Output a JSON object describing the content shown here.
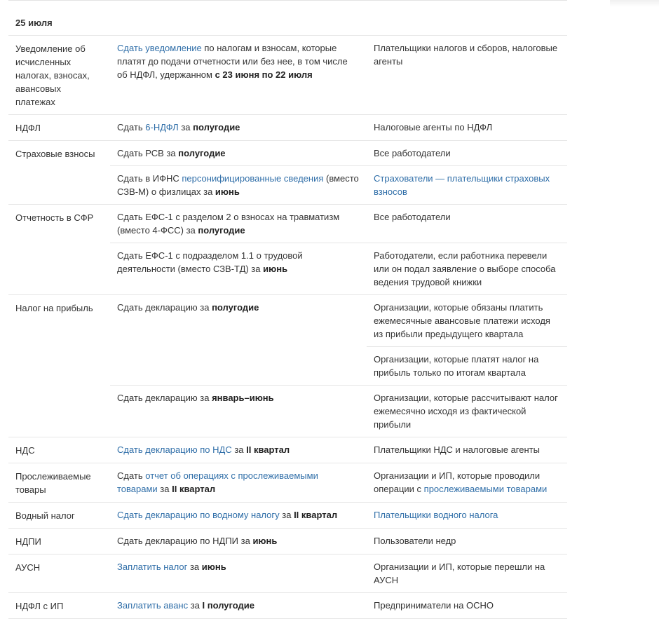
{
  "date_heading": "25 июля",
  "rows": [
    {
      "category": "Уведомление об исчисленных налогах, взносах, авансовых платежах",
      "action": {
        "link": "Сдать уведомление",
        "pre": "",
        "mid": " по налогам и взносам, которые платят до подачи отчетности или без нее, в том числе об НДФЛ, удержанном ",
        "bold": "с 23 июня по 22 июля",
        "post": ""
      },
      "payers": "Плательщики налогов и сборов, налоговые агенты"
    },
    {
      "category": "НДФЛ",
      "action": {
        "pre": "Сдать ",
        "link": "6-НДФЛ",
        "mid": " за ",
        "bold": "полугодие"
      },
      "payers": "Налоговые агенты по НДФЛ"
    },
    {
      "category": "Страховые взносы",
      "action": {
        "pre": "Сдать РСВ за ",
        "bold": "полугодие"
      },
      "payers": "Все работодатели"
    },
    {
      "category": "",
      "action": {
        "pre": "Сдать в ИФНС ",
        "link": "персонифицированные сведения",
        "mid": " (вместо СЗВ-М) о физлицах за ",
        "bold": "июнь"
      },
      "payers_link": "Страхователи — плательщики страховых взносов"
    },
    {
      "category": "Отчетность в СФР",
      "action": {
        "pre": "Сдать ЕФС-1 с разделом 2 о взносах на травматизм (вместо 4-ФСС) за ",
        "bold": "полугодие"
      },
      "payers": "Все работодатели"
    },
    {
      "category": "",
      "action": {
        "pre": "Сдать ЕФС-1 с подразделом 1.1 о трудовой деятельности (вместо СЗВ-ТД) за ",
        "bold": "июнь"
      },
      "payers": "Работодатели, если работника перевели или он подал заявление о выборе способа ведения трудовой книжки"
    },
    {
      "category": "Налог на прибыль",
      "action": {
        "pre": "Сдать декларацию за ",
        "bold": "полугодие"
      },
      "payers": "Организации, которые обязаны платить ежемесячные авансовые платежи исходя из прибыли предыдущего квартала"
    },
    {
      "category": "",
      "action": {},
      "payers": "Организации, которые платят налог на прибыль только по итогам квартала"
    },
    {
      "category": "",
      "action": {
        "pre": "Сдать декларацию за ",
        "bold": "январь–июнь"
      },
      "payers": "Организации, которые рассчитывают налог ежемесячно исходя из фактической прибыли"
    },
    {
      "category": "НДС",
      "action": {
        "link": "Сдать декларацию по НДС",
        "mid": " за ",
        "bold": "II квартал"
      },
      "payers": "Плательщики НДС и налоговые агенты"
    },
    {
      "category": "Прослеживаемые товары",
      "action": {
        "pre": "Сдать ",
        "link": "отчет об операциях с прослеживаемыми товарами",
        "mid": " за ",
        "bold": "II квартал"
      },
      "payers": "Организации и ИП, которые проводили операции с ",
      "payers_link": "прослеживаемыми товарами"
    },
    {
      "category": "Водный налог",
      "action": {
        "link": "Сдать декларацию по водному налогу",
        "mid": " за ",
        "bold": "II квартал"
      },
      "payers_link": "Плательщики водного налога"
    },
    {
      "category": "НДПИ",
      "action": {
        "pre": "Сдать декларацию по НДПИ за ",
        "bold": "июнь"
      },
      "payers": "Пользователи недр"
    },
    {
      "category": "АУСН",
      "action": {
        "link": "Заплатить налог",
        "mid": " за ",
        "bold": "июнь"
      },
      "payers": "Организации и ИП, которые перешли на АУСН"
    },
    {
      "category": "НДФЛ с ИП",
      "action": {
        "link": "Заплатить аванс",
        "mid": " за ",
        "bold": "I полугодие"
      },
      "payers": "Предприниматели на ОСНО"
    }
  ]
}
